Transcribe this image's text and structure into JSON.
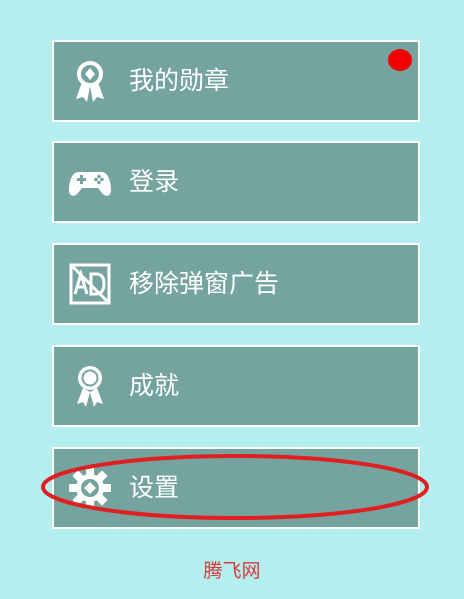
{
  "menu": {
    "items": [
      {
        "label": "我的勋章",
        "icon": "medal-icon",
        "has_badge": true
      },
      {
        "label": "登录",
        "icon": "gamepad-icon"
      },
      {
        "label": "移除弹窗广告",
        "icon": "no-ad-icon"
      },
      {
        "label": "成就",
        "icon": "ribbon-award-icon"
      },
      {
        "label": "设置",
        "icon": "gear-icon"
      }
    ]
  },
  "annotation": {
    "ring_color": "#e02020",
    "target": "设置"
  },
  "footer": {
    "watermark": "腾飞网"
  },
  "colors": {
    "background": "#b4eeef",
    "button": "#75a3a0",
    "border": "#ffffff",
    "badge": "#f40000"
  }
}
